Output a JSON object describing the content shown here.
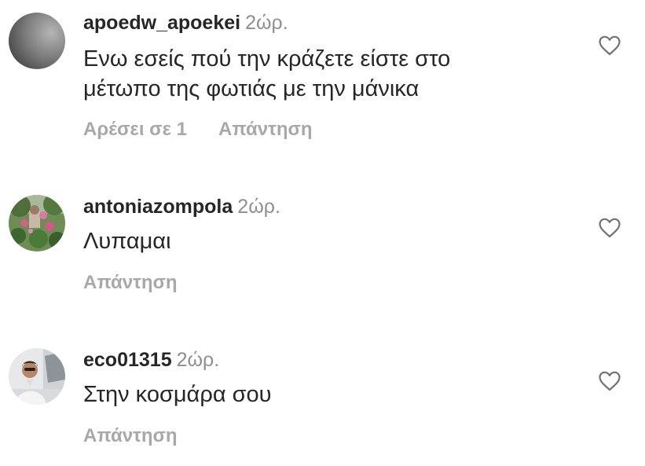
{
  "comments": [
    {
      "username": "apoedw_apoekei",
      "time": "2ώρ.",
      "text_lines": [
        "Ενω εσείς πού την κράζετε είστε στο",
        "μέτωπο της φωτιάς με την μάνικα"
      ],
      "likes_label": "Αρέσει σε 1",
      "reply_label": "Απάντηση",
      "avatar_icon": "avatar-gray-photo",
      "like_icon": "heart-outline-icon"
    },
    {
      "username": "antoniazompola",
      "time": "2ώρ.",
      "text_lines": [
        "Λυπαμαι"
      ],
      "reply_label": "Απάντηση",
      "avatar_icon": "avatar-garden-photo",
      "like_icon": "heart-outline-icon"
    },
    {
      "username": "eco01315",
      "time": "2ώρ.",
      "text_lines": [
        "Στην κοσμάρα σου"
      ],
      "reply_label": "Απάντηση",
      "avatar_icon": "avatar-person-in-car-photo",
      "like_icon": "heart-outline-icon"
    }
  ],
  "colors": {
    "text": "#262626",
    "secondary": "#8e8e8e",
    "action": "#a8a8a8"
  }
}
